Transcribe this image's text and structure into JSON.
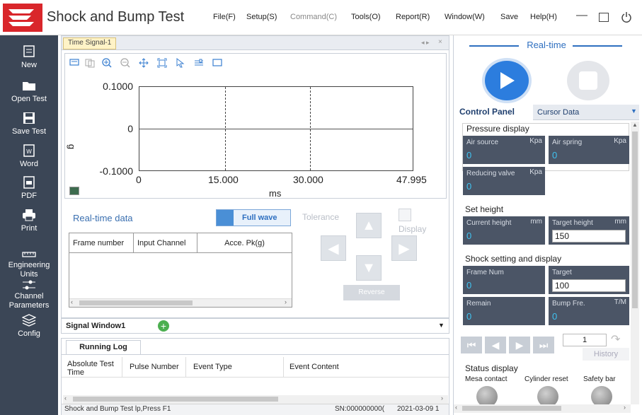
{
  "app": {
    "title": "Shock and Bump Test"
  },
  "menu": [
    "File(F)",
    "Setup(S)",
    "Command(C)",
    "Tools(O)",
    "Report(R)",
    "Window(W)",
    "Save",
    "Help(H)"
  ],
  "sidebar": [
    {
      "label": "New",
      "icon": "new-icon"
    },
    {
      "label": "Open Test",
      "icon": "folder-icon"
    },
    {
      "label": "Save Test",
      "icon": "save-icon"
    },
    {
      "label": "Word",
      "icon": "word-icon"
    },
    {
      "label": "PDF",
      "icon": "pdf-icon"
    },
    {
      "label": "Print",
      "icon": "print-icon"
    },
    {
      "label": "Engineering Units",
      "icon": "ruler-icon"
    },
    {
      "label": "Channel Parameters",
      "icon": "slider-icon"
    },
    {
      "label": "Config",
      "icon": "layers-icon"
    }
  ],
  "time_signal": {
    "tab": "Time Signal-1",
    "y_ticks": [
      "0.1000",
      "0",
      "-0.1000"
    ],
    "x_ticks": [
      "0",
      "15.000",
      "30.000",
      "47.995"
    ],
    "y_unit": "g",
    "x_unit": "ms"
  },
  "realtime_data": {
    "label": "Real-time data",
    "full_wave": "Full wave",
    "tolerance": "Tolerance",
    "display": "Display",
    "columns": [
      "Frame number",
      "Input Channel",
      "Acce. Pk(g)"
    ],
    "reverse": "Reverse"
  },
  "signal_window": {
    "tab": "Signal Window1"
  },
  "running_log": {
    "tab": "Running Log",
    "columns": [
      "Absolute Test Time",
      "Pulse Number",
      "Event Type",
      "Event Content"
    ]
  },
  "statusbar": {
    "left": "Shock and Bump Test lp,Press F1",
    "sn": "SN:000000000(",
    "date": "2021-03-09  1"
  },
  "right": {
    "title": "Real-time",
    "tab_control": "Control Panel",
    "tab_cursor": "Cursor Data",
    "pressure": {
      "title": "Pressure display",
      "air_source": {
        "label": "Air source",
        "unit": "Kpa",
        "value": "0"
      },
      "air_spring": {
        "label": "Air spring",
        "unit": "Kpa",
        "value": "0"
      },
      "reducing_valve": {
        "label": "Reducing valve",
        "unit": "Kpa",
        "value": "0"
      }
    },
    "height": {
      "title": "Set height",
      "current": {
        "label": "Current height",
        "unit": "mm",
        "value": "0"
      },
      "target": {
        "label": "Target height",
        "unit": "mm",
        "value": "150"
      }
    },
    "shock": {
      "title": "Shock setting and display",
      "frame_num": {
        "label": "Frame Num",
        "value": "0"
      },
      "target": {
        "label": "Target",
        "value": "100"
      },
      "remain": {
        "label": "Remain",
        "value": "0"
      },
      "bump_freq": {
        "label": "Bump Fre.",
        "unit": "T/M",
        "value": "0"
      }
    },
    "step_value": "1",
    "history": "History",
    "status": {
      "title": "Status display",
      "items": [
        "Mesa contact",
        "Cylinder reset",
        "Safety bar"
      ]
    }
  }
}
